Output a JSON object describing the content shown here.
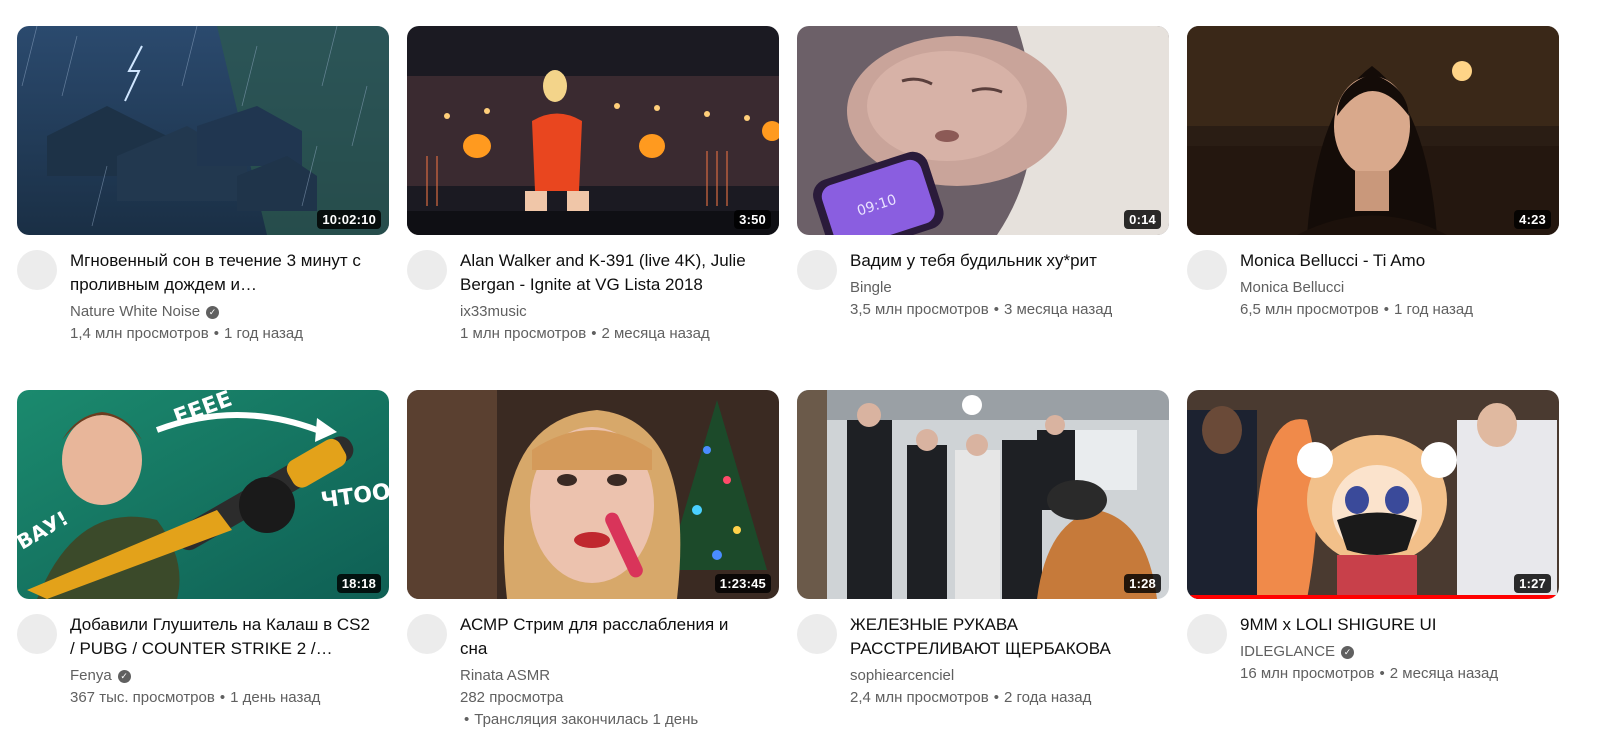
{
  "videos": [
    {
      "title": "Мгновенный сон в течение 3 минут с проливным дождем и…",
      "channel": "Nature White Noise",
      "verified": true,
      "views": "1,4 млн просмотров",
      "age": "1 год назад",
      "duration": "10:02:10",
      "thumbnail": "rainy-village-thumbnail"
    },
    {
      "title": "Alan Walker and K-391 (live 4K), Julie Bergan - Ignite at VG Lista 2018",
      "channel": "ix33music",
      "verified": false,
      "views": "1 млн просмотров",
      "age": "2 месяца назад",
      "duration": "3:50",
      "thumbnail": "concert-stage-thumbnail"
    },
    {
      "title": "Вадим у тебя будильник ху*рит",
      "channel": "Bingle",
      "verified": false,
      "views": "3,5 млн просмотров",
      "age": "3 месяца назад",
      "duration": "0:14",
      "thumbnail": "sleeping-boy-phone-thumbnail"
    },
    {
      "title": "Monica Bellucci - Ti Amo",
      "channel": "Monica Bellucci",
      "verified": false,
      "views": "6,5 млн просмотров",
      "age": "1 год назад",
      "duration": "4:23",
      "thumbnail": "woman-portrait-thumbnail"
    },
    {
      "title": "Добавили Глушитель на Калаш в CS2 / PUBG / COUNTER STRIKE 2 /…",
      "channel": "Fenya",
      "verified": true,
      "views": "367 тыс. просмотров",
      "age": "1 день назад",
      "duration": "18:18",
      "thumbnail": "gamer-silencer-thumbnail"
    },
    {
      "title": "АСМР Стрим для расслабления и сна",
      "channel": "Rinata ASMR",
      "verified": false,
      "views": "282 просмотра",
      "age": "Трансляция закончилась 1 день",
      "duration": "1:23:45",
      "thumbnail": "asmr-christmas-thumbnail"
    },
    {
      "title": "ЖЕЛЕЗНЫЕ РУКАВА РАССТРЕЛИВАЮТ ЩЕРБАКОВА",
      "channel": "sophiearcenciel",
      "verified": false,
      "views": "2,4 млн просмотров",
      "age": "2 года назад",
      "duration": "1:28",
      "thumbnail": "men-in-suits-thumbnail"
    },
    {
      "title": "9MM x LOLI SHIGURE UI",
      "channel": "IDLEGLANCE",
      "verified": true,
      "views": "16 млн просмотров",
      "age": "2 месяца назад",
      "duration": "1:27",
      "thumbnail": "anime-rappers-thumbnail",
      "watch_progress_percent": 100
    }
  ]
}
